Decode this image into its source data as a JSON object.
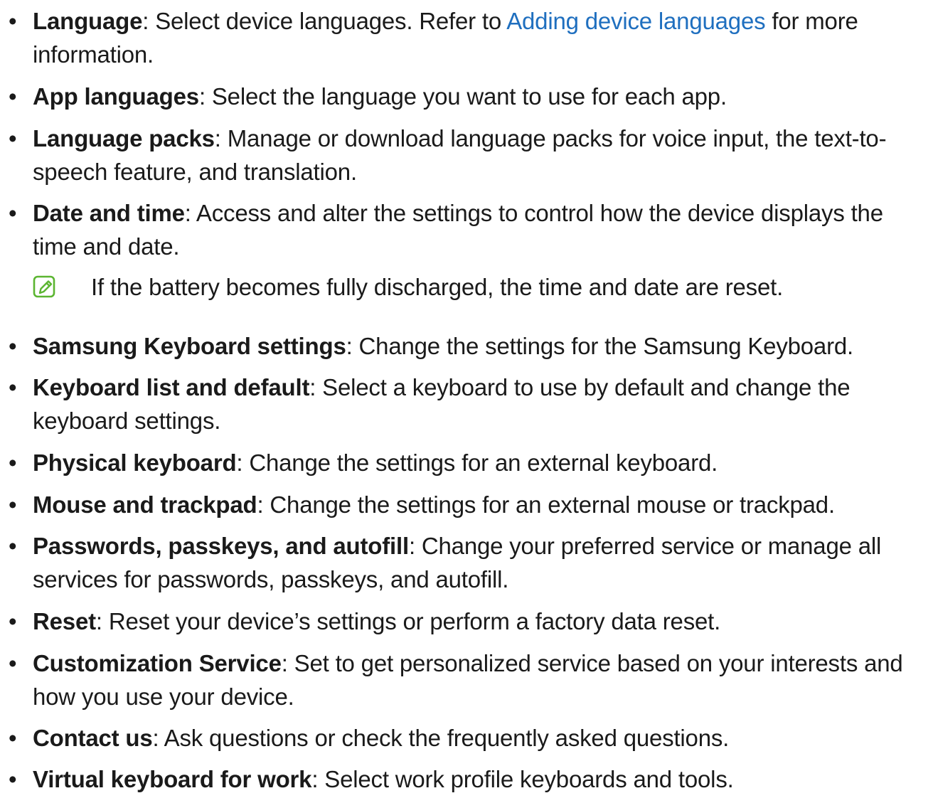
{
  "bullet_char": "•",
  "colors": {
    "text": "#1a1a1a",
    "link": "#1f6fbf",
    "note_icon": "#5bb531"
  },
  "items": [
    {
      "term": "Language",
      "sep": ": ",
      "lines": [
        {
          "before": "Select device languages. Refer to ",
          "link": "Adding device languages",
          "after": " for more"
        },
        {
          "text": "information."
        }
      ]
    },
    {
      "term": "App languages",
      "sep": ": ",
      "lines": [
        {
          "text": "Select the language you want to use for each app."
        }
      ]
    },
    {
      "term": "Language packs",
      "sep": ": ",
      "lines": [
        {
          "text": "Manage or download language packs for voice input, the text-to-"
        },
        {
          "text": "speech feature, and translation."
        }
      ]
    },
    {
      "term": "Date and time",
      "sep": ": ",
      "lines": [
        {
          "text": "Access and alter the settings to control how the device displays the"
        },
        {
          "text": "time and date."
        }
      ]
    },
    {
      "term": "Samsung Keyboard settings",
      "sep": ": ",
      "lines": [
        {
          "text": "Change the settings for the Samsung Keyboard."
        }
      ]
    },
    {
      "term": "Keyboard list and default",
      "sep": ": ",
      "lines": [
        {
          "text": "Select a keyboard to use by default and change the"
        },
        {
          "text": "keyboard settings."
        }
      ]
    },
    {
      "term": "Physical keyboard",
      "sep": ": ",
      "lines": [
        {
          "text": "Change the settings for an external keyboard."
        }
      ]
    },
    {
      "term": "Mouse and trackpad",
      "sep": ": ",
      "lines": [
        {
          "text": "Change the settings for an external mouse or trackpad."
        }
      ]
    },
    {
      "term": "Passwords, passkeys, and autofill",
      "sep": ": ",
      "lines": [
        {
          "text": "Change your preferred service or manage all"
        },
        {
          "text": "services for passwords, passkeys, and autofill."
        }
      ]
    },
    {
      "term": "Reset",
      "sep": ": ",
      "lines": [
        {
          "text": "Reset your device’s settings or perform a factory data reset."
        }
      ]
    },
    {
      "term": "Customization Service",
      "sep": ": ",
      "lines": [
        {
          "text": "Set to get personalized service based on your interests and"
        },
        {
          "text": "how you use your device."
        }
      ]
    },
    {
      "term": "Contact us",
      "sep": ": ",
      "lines": [
        {
          "text": "Ask questions or check the frequently asked questions."
        }
      ]
    },
    {
      "term": "Virtual keyboard for work",
      "sep": ": ",
      "lines": [
        {
          "text": "Select work profile keyboards and tools."
        }
      ]
    }
  ],
  "note": {
    "icon": "note-pencil-icon",
    "text": "If the battery becomes fully discharged, the time and date are reset."
  }
}
